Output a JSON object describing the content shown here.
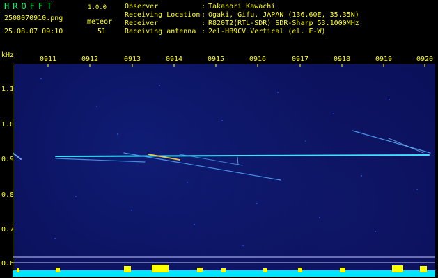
{
  "header": {
    "app_title": "HROFFT",
    "app_version": "1.0.0",
    "file_name": "2508070910.png",
    "timestamp": "25.08.07 09:10",
    "meteor_label": "meteor",
    "meteor_count": "51"
  },
  "info": [
    {
      "label": "Observer",
      "value": "Takanori Kawachi"
    },
    {
      "label": "Receiving Location",
      "value": "Ogaki, Gifu, JAPAN (136.60E, 35.35N)"
    },
    {
      "label": "Receiver",
      "value": "R820T2(RTL-SDR) SDR-Sharp 53.1000MHz"
    },
    {
      "label": "Receiving antenna",
      "value": "2el-HB9CV Vertical (el. E-W)"
    }
  ],
  "separator": ":",
  "axis": {
    "unit": "kHz",
    "y_ticks": [
      "1.1",
      "1.0",
      "0.9",
      "0.8",
      "0.7",
      "0.6"
    ],
    "x_ticks": [
      "0911",
      "0912",
      "0913",
      "0914",
      "0915",
      "0916",
      "0917",
      "0918",
      "0919",
      "0920"
    ]
  },
  "colors": {
    "text": "#ffff00",
    "title": "#00ff66",
    "background": "#000000",
    "spectrogram": "#0a0f58",
    "carrier": "#40e0ff",
    "spectrum_fill": "#00e5ff",
    "spectrum_peak": "#ffff00"
  }
}
